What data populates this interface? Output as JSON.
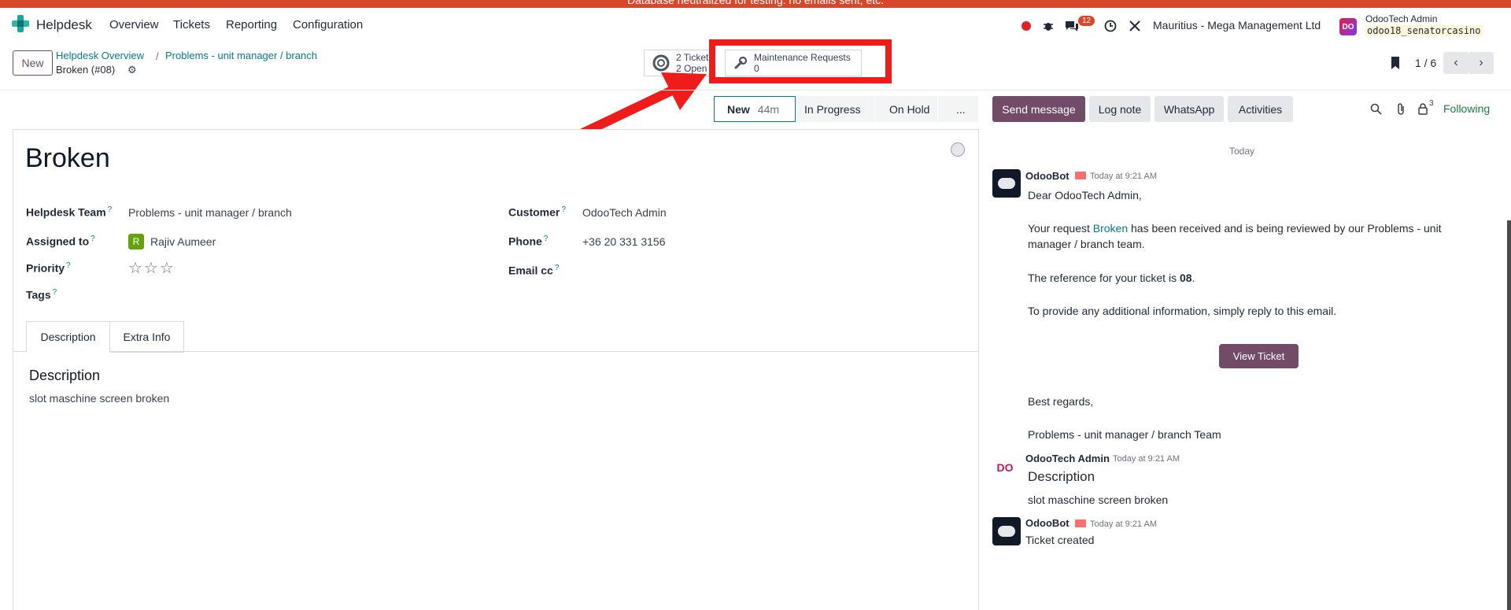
{
  "banner": {
    "text": "Database neutralized for testing: no emails sent, etc."
  },
  "navbar": {
    "app_name": "Helpdesk",
    "menu": [
      "Overview",
      "Tickets",
      "Reporting",
      "Configuration"
    ],
    "message_count": "12",
    "company": "Mauritius - Mega Management Ltd",
    "user_initials": "DO",
    "user_name": "OdooTech Admin",
    "db_name": "odoo18_senatorcasino"
  },
  "control": {
    "new_label": "New",
    "breadcrumbs": [
      "Helpdesk Overview",
      "Problems - unit manager / branch"
    ],
    "record_title": "Broken (#08)",
    "smart_tickets": {
      "line1": "2 Ticket",
      "line2": "2 Open"
    },
    "smart_maintenance": {
      "label": "Maintenance Requests",
      "count": "0"
    },
    "pager": "1 / 6"
  },
  "status": {
    "stages": [
      "New",
      "In Progress",
      "On Hold",
      "..."
    ],
    "active_duration": "44m"
  },
  "form": {
    "title": "Broken",
    "team_label": "Helpdesk Team",
    "team_value": "Problems - unit manager / branch",
    "assigned_label": "Assigned to",
    "assigned_initial": "R",
    "assigned_value": "Rajiv Aumeer",
    "priority_label": "Priority",
    "priority_stars": "☆☆☆",
    "tags_label": "Tags",
    "customer_label": "Customer",
    "customer_value": "OdooTech Admin",
    "phone_label": "Phone",
    "phone_value": "+36 20 331 3156",
    "emailcc_label": "Email cc",
    "help_mark": "?",
    "tabs": [
      "Description",
      "Extra Info"
    ],
    "desc_heading": "Description",
    "desc_body": "slot maschine screen broken"
  },
  "chatter": {
    "send": "Send message",
    "log": "Log note",
    "whatsapp": "WhatsApp",
    "activities": "Activities",
    "followers": "3",
    "following": "Following",
    "today": "Today",
    "m1": {
      "author": "OdooBot",
      "time": "Today at 9:21 AM",
      "greeting": "Dear OdooTech Admin,",
      "p1a": "Your request ",
      "p1link": "Broken",
      "p1b": " has been received and is being reviewed by our Problems - unit",
      "p1c": "manager / branch team.",
      "p2a": "The reference for your ticket is ",
      "p2b": "08",
      "p2c": ".",
      "p3": "To provide any additional information, simply reply to this email.",
      "button": "View Ticket",
      "regards": "Best regards,",
      "sign": "Problems - unit manager / branch Team"
    },
    "m2": {
      "author": "OdooTech Admin",
      "initials": "DO",
      "time": "Today at 9:21 AM",
      "heading": "Description",
      "body": "slot maschine screen broken"
    },
    "m3": {
      "author": "OdooBot",
      "time": "Today at 9:21 AM",
      "body": "Ticket created"
    }
  }
}
